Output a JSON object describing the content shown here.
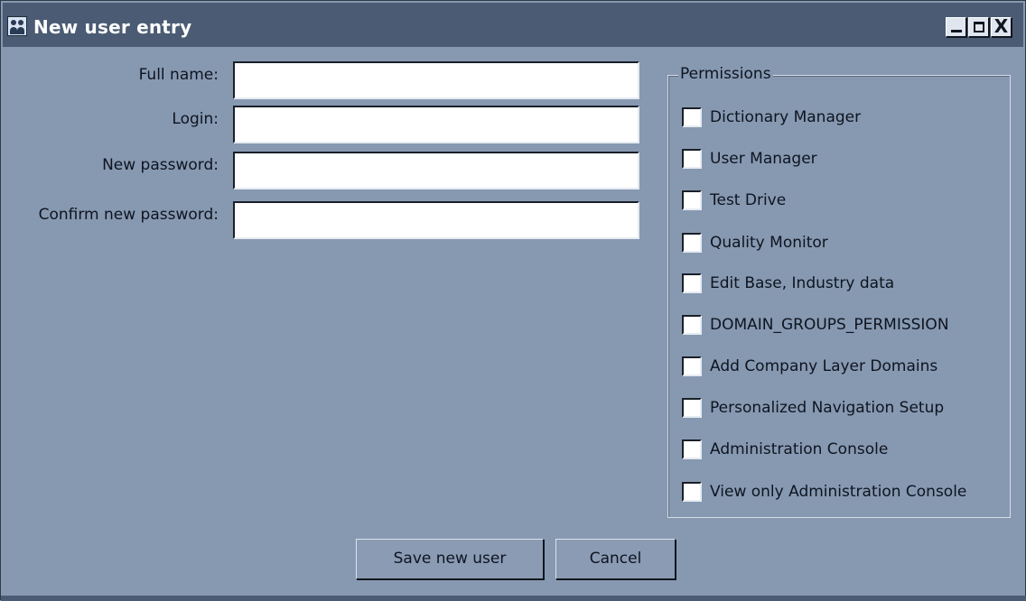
{
  "window": {
    "title": "New user entry",
    "icon": "users-icon",
    "controls": [
      "minimize-icon",
      "maximize-icon",
      "close-icon"
    ],
    "close_glyph": "X"
  },
  "form": {
    "fields": [
      {
        "label": "Full name:",
        "value": "",
        "placeholder": ""
      },
      {
        "label": "Login:",
        "value": "",
        "placeholder": ""
      },
      {
        "label": "New password:",
        "value": "",
        "placeholder": ""
      },
      {
        "label": "Confirm new password:",
        "value": "",
        "placeholder": ""
      }
    ]
  },
  "permissions": {
    "legend": "Permissions",
    "items": [
      {
        "label": "Dictionary Manager",
        "checked": false
      },
      {
        "label": "User Manager",
        "checked": false
      },
      {
        "label": "Test Drive",
        "checked": false
      },
      {
        "label": "Quality Monitor",
        "checked": false
      },
      {
        "label": "Edit Base, Industry data",
        "checked": false
      },
      {
        "label": "DOMAIN_GROUPS_PERMISSION",
        "checked": false
      },
      {
        "label": "Add Company Layer Domains",
        "checked": false
      },
      {
        "label": "Personalized Navigation Setup",
        "checked": false
      },
      {
        "label": "Administration Console",
        "checked": false
      },
      {
        "label": "View only Administration Console",
        "checked": false
      }
    ]
  },
  "actions": {
    "save_label": "Save new user",
    "cancel_label": "Cancel"
  },
  "colors": {
    "background": "#8799b1",
    "titlebar": "#4a5b73",
    "title_text": "#ffffff"
  }
}
